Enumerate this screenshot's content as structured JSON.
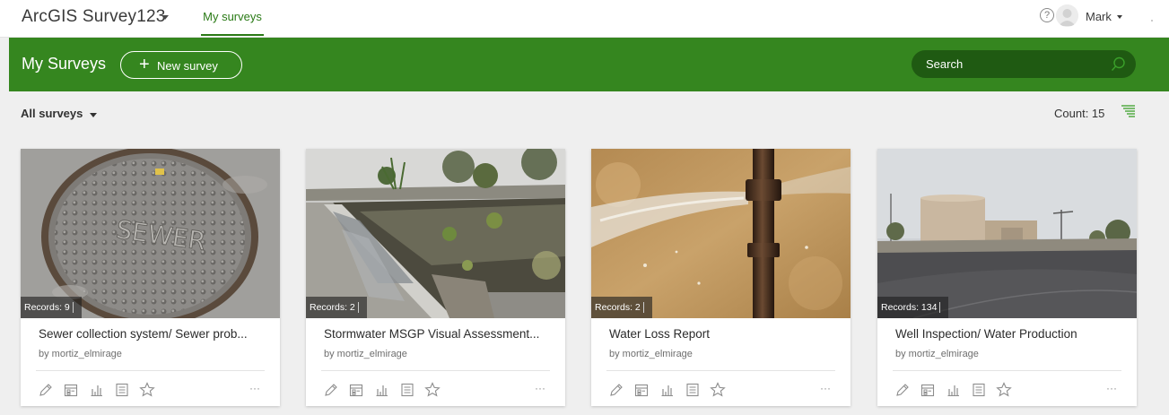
{
  "topnav": {
    "app_title": "ArcGIS Survey123",
    "nav_link": "My surveys",
    "help_glyph": "?",
    "user_name": "Mark"
  },
  "header": {
    "title": "My Surveys",
    "new_survey_label": "New survey",
    "search_placeholder": "Search"
  },
  "filter": {
    "label": "All surveys",
    "count_label": "Count: 15"
  },
  "cards": [
    {
      "records": "Records: 9",
      "title": "Sewer collection system/ Sewer prob...",
      "owner": "by mortiz_elmirage"
    },
    {
      "records": "Records: 2",
      "title": "Stormwater MSGP Visual Assessment...",
      "owner": "by mortiz_elmirage"
    },
    {
      "records": "Records: 2",
      "title": "Water Loss Report",
      "owner": "by mortiz_elmirage"
    },
    {
      "records": "Records: 134",
      "title": "Well Inspection/ Water Production",
      "owner": "by mortiz_elmirage"
    }
  ],
  "card_actions": {
    "more_glyph": "···"
  },
  "icons": [
    "help-icon",
    "avatar",
    "plus-icon",
    "search-icon",
    "sort-icon",
    "link-icon",
    "edit-icon",
    "form-icon",
    "analyze-icon",
    "data-icon",
    "star-icon",
    "more-icon"
  ],
  "colors": {
    "brand_green": "#35861f",
    "search_bg": "#1f5a12",
    "nav_active": "#2a7a16",
    "page_bg": "#efefef"
  }
}
